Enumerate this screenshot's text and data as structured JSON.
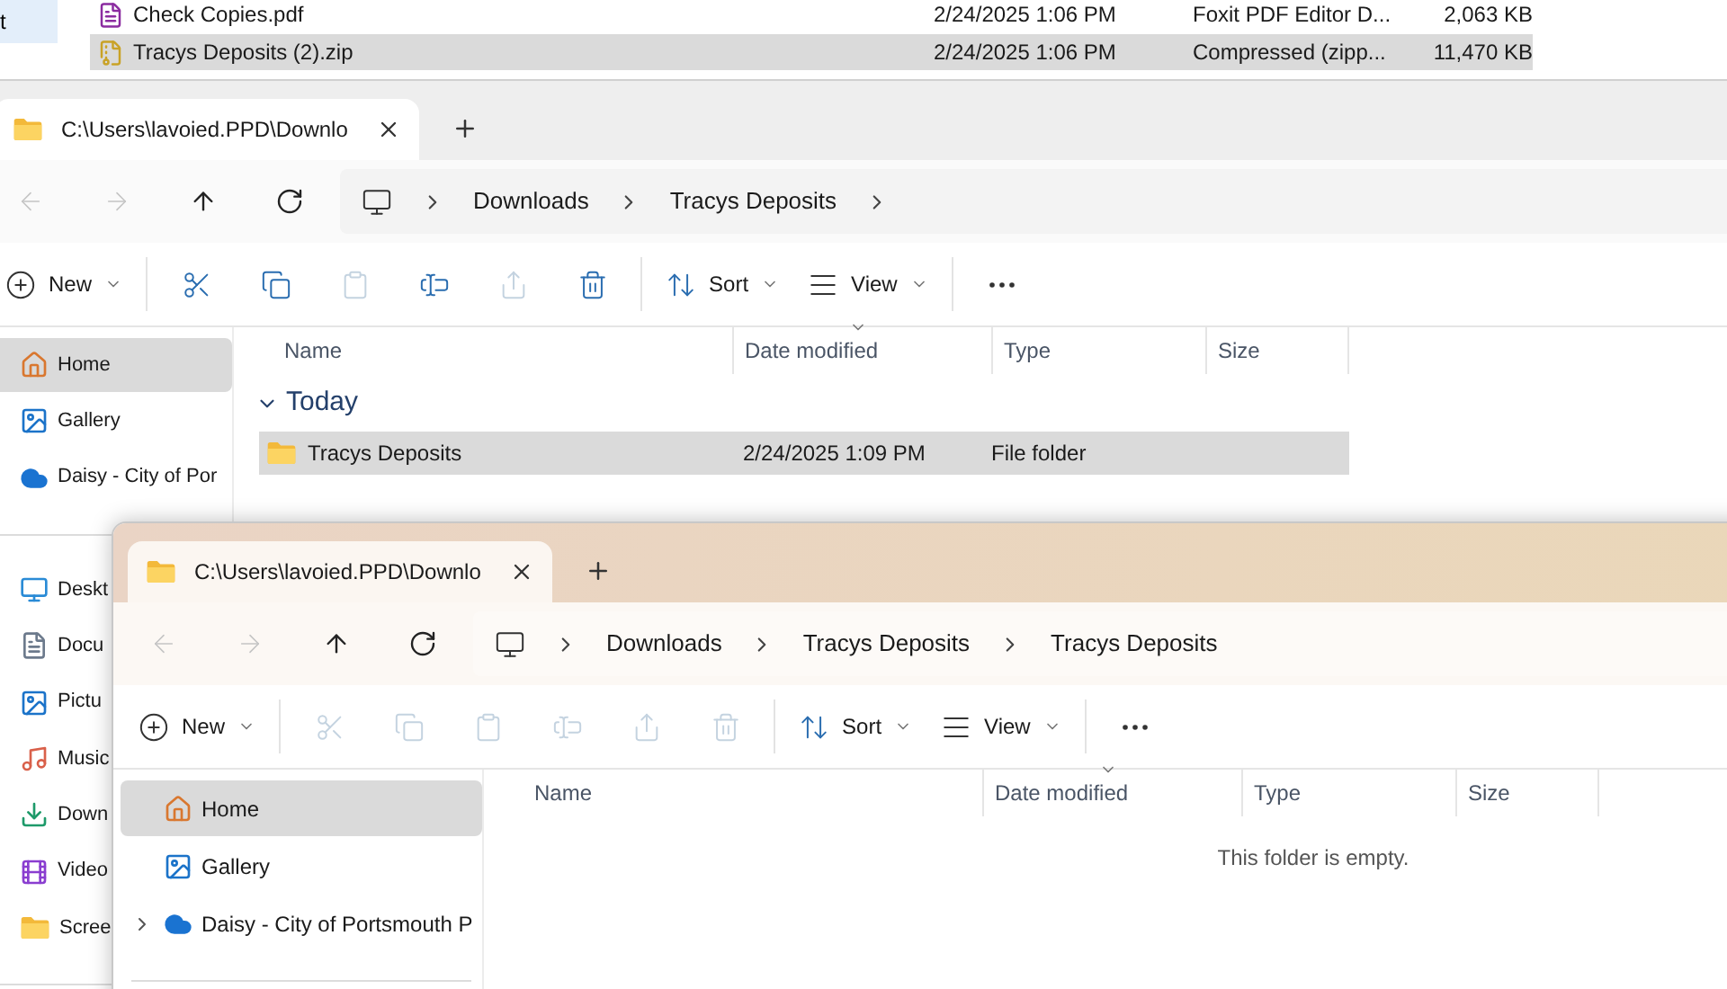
{
  "back_window": {
    "sidebar_items": [
      {
        "label": "t",
        "selected": true
      }
    ],
    "rows": [
      {
        "kind": "pdf",
        "name": "Check Copies.pdf",
        "date": "2/24/2025 1:06 PM",
        "type": "Foxit PDF Editor D...",
        "size": "2,063 KB",
        "selected": false
      },
      {
        "kind": "zip",
        "name": "Tracys Deposits (2).zip",
        "date": "2/24/2025 1:06 PM",
        "type": "Compressed (zipp...",
        "size": "11,470 KB",
        "selected": true
      }
    ]
  },
  "windows": [
    {
      "tab_title": "C:\\Users\\lavoied.PPD\\Downlo",
      "breadcrumbs": [
        "Downloads",
        "Tracys Deposits"
      ],
      "has_subfolders": true,
      "nav": [
        {
          "kind": "back",
          "disabled": true
        },
        {
          "kind": "forward",
          "disabled": true
        },
        {
          "kind": "up",
          "disabled": false
        },
        {
          "kind": "refresh",
          "disabled": false
        }
      ],
      "toolbar": [
        {
          "kind": "new",
          "label": "New",
          "disabled": false
        },
        {
          "kind": "cut",
          "disabled": false
        },
        {
          "kind": "copy",
          "disabled": false
        },
        {
          "kind": "paste",
          "disabled": true
        },
        {
          "kind": "rename",
          "disabled": false
        },
        {
          "kind": "share",
          "disabled": true
        },
        {
          "kind": "delete",
          "disabled": false
        },
        {
          "kind": "sort",
          "label": "Sort",
          "disabled": false
        },
        {
          "kind": "view",
          "label": "View",
          "disabled": false
        },
        {
          "kind": "more",
          "disabled": false
        }
      ],
      "sidebar_sections": [
        [
          {
            "kind": "home",
            "label": "Home",
            "selected": true
          },
          {
            "kind": "gallery",
            "label": "Gallery",
            "selected": false
          },
          {
            "kind": "cloud",
            "label": "Daisy - City of Por",
            "selected": false
          }
        ],
        [
          {
            "kind": "desktop",
            "label": "Deskt",
            "selected": false
          },
          {
            "kind": "documents",
            "label": "Docu",
            "selected": false
          },
          {
            "kind": "pictures",
            "label": "Pictu",
            "selected": false
          },
          {
            "kind": "music",
            "label": "Music",
            "selected": false
          },
          {
            "kind": "downloads",
            "label": "Down",
            "selected": false
          },
          {
            "kind": "videos",
            "label": "Video",
            "selected": false
          },
          {
            "kind": "folder",
            "label": "Scree",
            "selected": false
          }
        ]
      ],
      "columns": [
        {
          "label": "Name",
          "sorted": false
        },
        {
          "label": "Date modified",
          "sorted": true
        },
        {
          "label": "Type",
          "sorted": false
        },
        {
          "label": "Size",
          "sorted": false
        }
      ],
      "groups": [
        {
          "label": "Today",
          "expanded": true,
          "rows": [
            {
              "kind": "folder",
              "name": "Tracys Deposits",
              "date": "2/24/2025 1:09 PM",
              "type": "File folder",
              "size": "",
              "selected": true
            }
          ]
        }
      ]
    },
    {
      "tab_title": "C:\\Users\\lavoied.PPD\\Downlo",
      "breadcrumbs": [
        "Downloads",
        "Tracys Deposits",
        "Tracys Deposits"
      ],
      "has_subfolders": false,
      "nav": [
        {
          "kind": "back",
          "disabled": true
        },
        {
          "kind": "forward",
          "disabled": true
        },
        {
          "kind": "up",
          "disabled": false
        },
        {
          "kind": "refresh",
          "disabled": false
        }
      ],
      "toolbar": [
        {
          "kind": "new",
          "label": "New",
          "disabled": false
        },
        {
          "kind": "cut",
          "disabled": true
        },
        {
          "kind": "copy",
          "disabled": true
        },
        {
          "kind": "paste",
          "disabled": true
        },
        {
          "kind": "rename",
          "disabled": true
        },
        {
          "kind": "share",
          "disabled": true
        },
        {
          "kind": "delete",
          "disabled": true
        },
        {
          "kind": "sort",
          "label": "Sort",
          "disabled": false
        },
        {
          "kind": "view",
          "label": "View",
          "disabled": false
        },
        {
          "kind": "more",
          "disabled": false
        }
      ],
      "sidebar_sections": [
        [
          {
            "kind": "home",
            "label": "Home",
            "selected": true,
            "expandable": false
          },
          {
            "kind": "gallery",
            "label": "Gallery",
            "selected": false,
            "expandable": false
          },
          {
            "kind": "cloud",
            "label": "Daisy - City of Portsmouth P",
            "selected": false,
            "expandable": true
          }
        ]
      ],
      "columns": [
        {
          "label": "Name",
          "sorted": false
        },
        {
          "label": "Date modified",
          "sorted": true
        },
        {
          "label": "Type",
          "sorted": false
        },
        {
          "label": "Size",
          "sorted": false
        }
      ],
      "empty_message": "This folder is empty."
    }
  ]
}
